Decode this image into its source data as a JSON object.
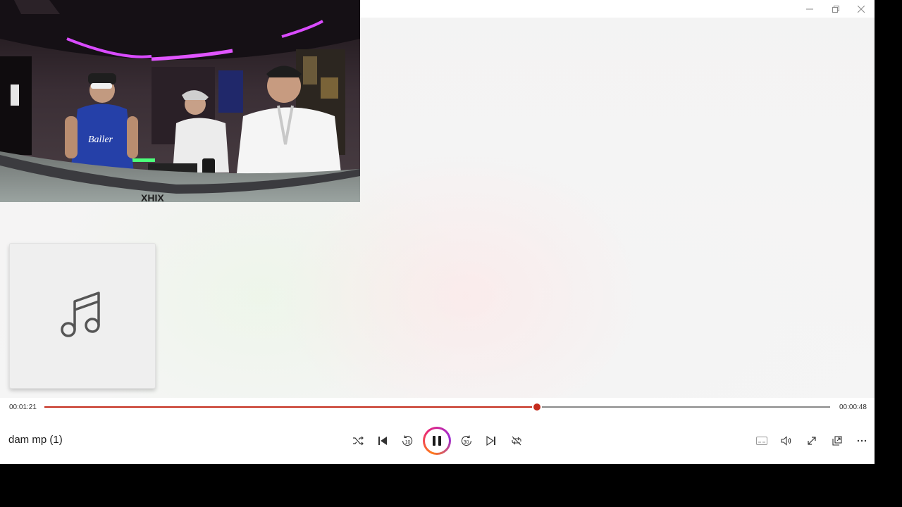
{
  "window": {
    "controls": [
      "minimize-icon",
      "restore-icon",
      "close-icon"
    ]
  },
  "player": {
    "track_title": "dam mp (1)",
    "elapsed": "00:01:21",
    "remaining": "00:00:48",
    "progress": 0.627,
    "state": "playing",
    "accent_color": "#c42b1c",
    "transport_icons": [
      "shuffle-icon",
      "previous-icon",
      "rewind-10-icon",
      "pause-icon",
      "forward-30-icon",
      "next-icon",
      "repeat-icon"
    ],
    "right_icons": [
      "captions-icon",
      "volume-icon",
      "fullscreen-icon",
      "mini-player-icon",
      "more-icon"
    ],
    "rewind_label": "10",
    "forward_label": "30"
  },
  "album_art": {
    "icon": "music-note-icon"
  }
}
